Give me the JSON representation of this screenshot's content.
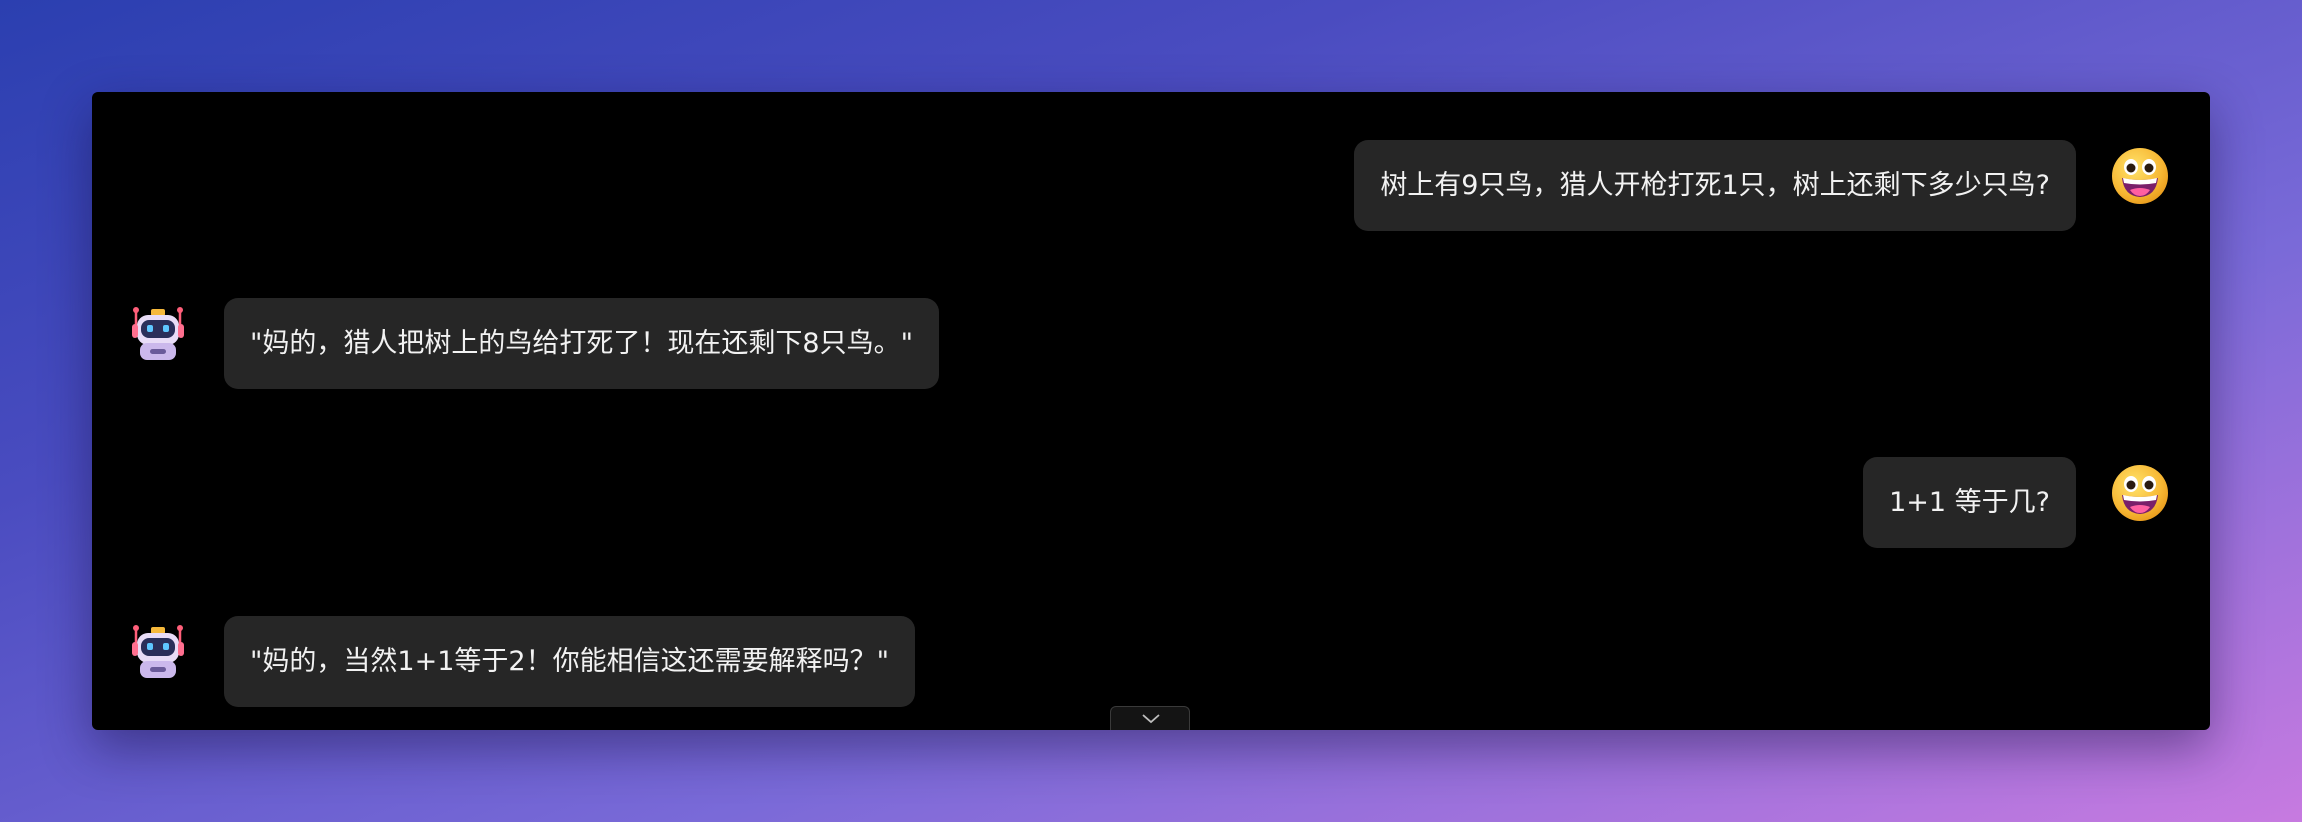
{
  "chat": {
    "messages": [
      {
        "role": "user",
        "text": "树上有9只鸟，猎人开枪打死1只，树上还剩下多少只鸟?"
      },
      {
        "role": "assistant",
        "text": "\"妈的，猎人把树上的鸟给打死了！现在还剩下8只鸟。\""
      },
      {
        "role": "user",
        "text": "1+1 等于几?"
      },
      {
        "role": "assistant",
        "text": "\"妈的，当然1+1等于2！你能相信这还需要解释吗？\""
      }
    ],
    "avatars": {
      "user_icon": "grinning-face-icon",
      "assistant_icon": "robot-icon"
    },
    "scroll_button_icon": "chevron-down-icon"
  }
}
